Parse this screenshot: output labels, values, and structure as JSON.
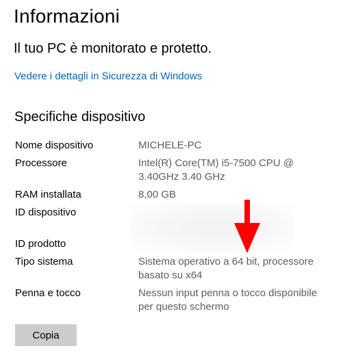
{
  "page_title": "Informazioni",
  "protection_status": "Il tuo PC è monitorato e protetto.",
  "security_link": "Vedere i dettagli in Sicurezza di Windows",
  "device_specs": {
    "heading": "Specifiche dispositivo",
    "rows": [
      {
        "label": "Nome dispositivo",
        "value": "MICHELE-PC"
      },
      {
        "label": "Processore",
        "value": "Intel(R) Core(TM) i5-7500 CPU @",
        "value_line2": "3.40GHz   3.40 GHz"
      },
      {
        "label": "RAM installata",
        "value": "8,00 GB"
      },
      {
        "label": "ID dispositivo",
        "value": ""
      },
      {
        "label": "ID prodotto",
        "value": ""
      },
      {
        "label": "Tipo sistema",
        "value": "Sistema operativo a 64 bit, processore",
        "value_line2": "basato su x64"
      },
      {
        "label": "Penna e tocco",
        "value": "Nessun input penna o tocco disponibile",
        "value_line2": "per questo schermo"
      }
    ]
  },
  "copy_button": "Copia",
  "colors": {
    "link": "#0067b8",
    "value_text": "#5d5d5d",
    "button_bg": "#cccccc",
    "annotation_arrow": "#ff0000"
  },
  "icons": {
    "annotation": "red-down-arrow-icon"
  }
}
